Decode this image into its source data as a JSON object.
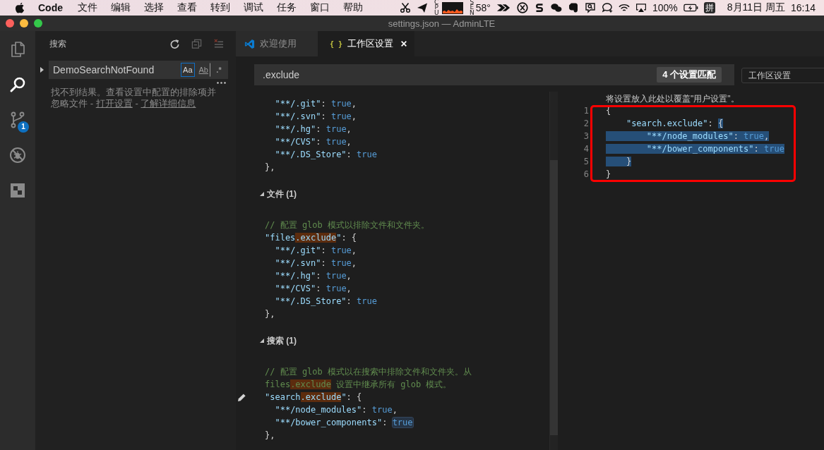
{
  "menu_bar": {
    "app_name": "Code",
    "menus": [
      "文件",
      "编辑",
      "选择",
      "查看",
      "转到",
      "调试",
      "任务",
      "窗口",
      "帮助"
    ],
    "cpu_label": "CPU",
    "sensor_label": "SEN",
    "temperature": "58°",
    "battery": "100%",
    "input_method": "拼",
    "date": "8月11日 周五",
    "time": "16:14"
  },
  "window": {
    "title": "settings.json — AdminLTE"
  },
  "activity_bar": {
    "items": [
      {
        "kind": "explorer",
        "selected": false
      },
      {
        "kind": "search",
        "selected": true
      },
      {
        "kind": "source_control",
        "selected": false,
        "badge": "1"
      },
      {
        "kind": "debug",
        "selected": false
      },
      {
        "kind": "extensions",
        "selected": false
      }
    ]
  },
  "sidebar": {
    "title": "搜索",
    "search": {
      "value": "DemoSearchNotFound",
      "replace_expanded": false,
      "options": [
        {
          "label": "Aa",
          "selected": true
        },
        {
          "label": "Ab",
          "selected": false
        },
        {
          "label": ".*",
          "selected": false
        }
      ]
    },
    "message": [
      {
        "kind": "text",
        "text": "找不到结果。查看设置中配置的排除项并忽略文件 - "
      },
      {
        "kind": "link",
        "text": "打开设置"
      },
      {
        "kind": "text",
        "text": " - "
      },
      {
        "kind": "link",
        "text": "了解详细信息"
      }
    ]
  },
  "tabs": [
    {
      "kind": "welcome",
      "label": "欢迎使用",
      "selected": false
    },
    {
      "kind": "json",
      "icon_text": "{ }",
      "label": "工作区设置",
      "selected": true
    }
  ],
  "settings_header": {
    "search": {
      "value": ".exclude"
    },
    "match_count": "4 个设置匹配",
    "target": "工作区设置"
  },
  "default_settings": {
    "lines": [
      {
        "tokens": [
          {
            "kind": "key",
            "text": "  \"**/.git\""
          },
          {
            "kind": "punct",
            "text": ": "
          },
          {
            "kind": "bool",
            "text": "true"
          },
          {
            "kind": "punct",
            "text": ","
          }
        ]
      },
      {
        "tokens": [
          {
            "kind": "key",
            "text": "  \"**/.svn\""
          },
          {
            "kind": "punct",
            "text": ": "
          },
          {
            "kind": "bool",
            "text": "true"
          },
          {
            "kind": "punct",
            "text": ","
          }
        ]
      },
      {
        "tokens": [
          {
            "kind": "key",
            "text": "  \"**/.hg\""
          },
          {
            "kind": "punct",
            "text": ": "
          },
          {
            "kind": "bool",
            "text": "true"
          },
          {
            "kind": "punct",
            "text": ","
          }
        ]
      },
      {
        "tokens": [
          {
            "kind": "key",
            "text": "  \"**/CVS\""
          },
          {
            "kind": "punct",
            "text": ": "
          },
          {
            "kind": "bool",
            "text": "true"
          },
          {
            "kind": "punct",
            "text": ","
          }
        ]
      },
      {
        "tokens": [
          {
            "kind": "key",
            "text": "  \"**/.DS_Store\""
          },
          {
            "kind": "punct",
            "text": ": "
          },
          {
            "kind": "bool",
            "text": "true"
          }
        ]
      },
      {
        "tokens": [
          {
            "kind": "punct",
            "text": "},"
          }
        ]
      }
    ],
    "groups": [
      {
        "title": "文件 (1)",
        "expanded": true,
        "lines": [
          {
            "tokens": [
              {
                "kind": "comment",
                "text": "// 配置 glob 模式以排除文件和文件夹。"
              }
            ]
          },
          {
            "tokens": [
              {
                "kind": "key",
                "text": "\"files",
                "matched": false
              },
              {
                "kind": "key",
                "text": ".exclude",
                "matched": true
              },
              {
                "kind": "key",
                "text": "\"",
                "matched": false
              },
              {
                "kind": "punct",
                "text": ": {",
                "matched": false
              }
            ]
          },
          {
            "tokens": [
              {
                "kind": "key",
                "text": "  \"**/.git\""
              },
              {
                "kind": "punct",
                "text": ": "
              },
              {
                "kind": "bool",
                "text": "true"
              },
              {
                "kind": "punct",
                "text": ","
              }
            ]
          },
          {
            "tokens": [
              {
                "kind": "key",
                "text": "  \"**/.svn\""
              },
              {
                "kind": "punct",
                "text": ": "
              },
              {
                "kind": "bool",
                "text": "true"
              },
              {
                "kind": "punct",
                "text": ","
              }
            ]
          },
          {
            "tokens": [
              {
                "kind": "key",
                "text": "  \"**/.hg\""
              },
              {
                "kind": "punct",
                "text": ": "
              },
              {
                "kind": "bool",
                "text": "true"
              },
              {
                "kind": "punct",
                "text": ","
              }
            ]
          },
          {
            "tokens": [
              {
                "kind": "key",
                "text": "  \"**/CVS\""
              },
              {
                "kind": "punct",
                "text": ": "
              },
              {
                "kind": "bool",
                "text": "true"
              },
              {
                "kind": "punct",
                "text": ","
              }
            ]
          },
          {
            "tokens": [
              {
                "kind": "key",
                "text": "  \"**/.DS_Store\""
              },
              {
                "kind": "punct",
                "text": ": "
              },
              {
                "kind": "bool",
                "text": "true"
              }
            ]
          },
          {
            "tokens": [
              {
                "kind": "punct",
                "text": "},"
              }
            ]
          }
        ]
      },
      {
        "title": "搜索 (1)",
        "expanded": true,
        "lines": [
          {
            "edit_icon": false,
            "tokens": [
              {
                "kind": "comment",
                "text": "// 配置 glob 模式以在搜索中排除文件和文件夹。从"
              }
            ]
          },
          {
            "edit_icon": false,
            "tokens": [
              {
                "kind": "comment",
                "text": "files",
                "matched": false
              },
              {
                "kind": "comment",
                "text": ".exclude",
                "matched": true
              },
              {
                "kind": "comment",
                "text": " 设置中继承所有 glob 模式。",
                "matched": false
              }
            ]
          },
          {
            "edit_icon": true,
            "tokens": [
              {
                "kind": "key",
                "text": "\"search",
                "matched": false
              },
              {
                "kind": "key",
                "text": ".exclude",
                "matched": true
              },
              {
                "kind": "key",
                "text": "\"",
                "matched": false
              },
              {
                "kind": "punct",
                "text": ": {",
                "matched": false
              }
            ]
          },
          {
            "edit_icon": false,
            "tokens": [
              {
                "kind": "key",
                "text": "  \"**/node_modules\""
              },
              {
                "kind": "punct",
                "text": ": "
              },
              {
                "kind": "bool",
                "text": "true"
              },
              {
                "kind": "punct",
                "text": ","
              }
            ]
          },
          {
            "edit_icon": false,
            "tokens": [
              {
                "kind": "key",
                "text": "  \"**/bower_components\"",
                "highlighted": false
              },
              {
                "kind": "punct",
                "text": ": ",
                "highlighted": false
              },
              {
                "kind": "bool",
                "text": "true",
                "highlighted": true
              }
            ]
          },
          {
            "edit_icon": false,
            "tokens": [
              {
                "kind": "punct",
                "text": "},"
              }
            ]
          }
        ]
      }
    ]
  },
  "workspace_settings": {
    "hint": "将设置放入此处以覆盖\"用户设置\"。",
    "lines": [
      {
        "number": "1",
        "tokens": [
          {
            "kind": "punct",
            "text": "{"
          }
        ]
      },
      {
        "number": "2",
        "tokens": [
          {
            "kind": "key",
            "text": "    \"search.exclude\"",
            "selected": false
          },
          {
            "kind": "punct",
            "text": ": ",
            "selected": false
          },
          {
            "kind": "punct",
            "text": "{",
            "selected": true
          }
        ]
      },
      {
        "number": "3",
        "tokens": [
          {
            "kind": "key",
            "text": "        \"**/node_modules\"",
            "selected": true
          },
          {
            "kind": "punct",
            "text": ": ",
            "selected": true
          },
          {
            "kind": "bool",
            "text": "true",
            "selected": true
          },
          {
            "kind": "punct",
            "text": ",",
            "selected": true
          }
        ]
      },
      {
        "number": "4",
        "tokens": [
          {
            "kind": "key",
            "text": "        \"**/bower_components\"",
            "selected": true
          },
          {
            "kind": "punct",
            "text": ": ",
            "selected": true
          },
          {
            "kind": "bool",
            "text": "true",
            "selected": true
          }
        ]
      },
      {
        "number": "5",
        "tokens": [
          {
            "kind": "punct",
            "text": "    }",
            "selected": true
          }
        ]
      },
      {
        "number": "6",
        "tokens": [
          {
            "kind": "punct",
            "text": "}"
          }
        ]
      }
    ]
  }
}
